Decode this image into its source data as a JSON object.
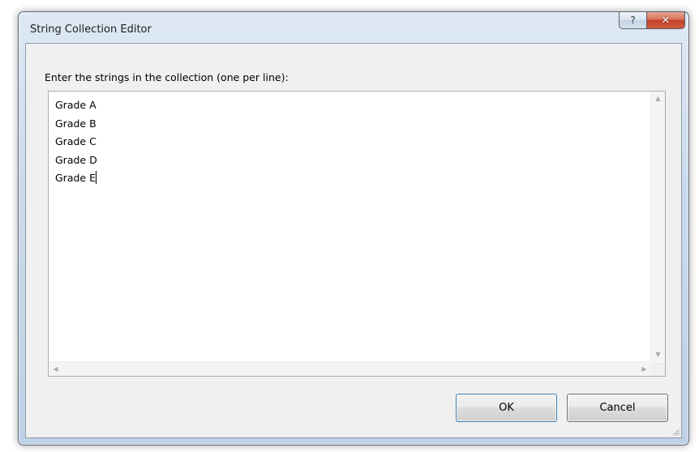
{
  "window": {
    "title": "String Collection Editor",
    "help_glyph": "?",
    "close_glyph": "✕"
  },
  "editor": {
    "prompt": "Enter the strings in the collection (one per line):",
    "lines": [
      "Grade A",
      "Grade B",
      "Grade C",
      "Grade D",
      "Grade E"
    ]
  },
  "scrollbars": {
    "up_arrow": "▲",
    "down_arrow": "▼",
    "left_arrow": "◀",
    "right_arrow": "▶"
  },
  "buttons": {
    "ok_label": "OK",
    "cancel_label": "Cancel"
  },
  "colors": {
    "close_button": "#c2432a",
    "default_button_border": "#3c7fb1"
  }
}
